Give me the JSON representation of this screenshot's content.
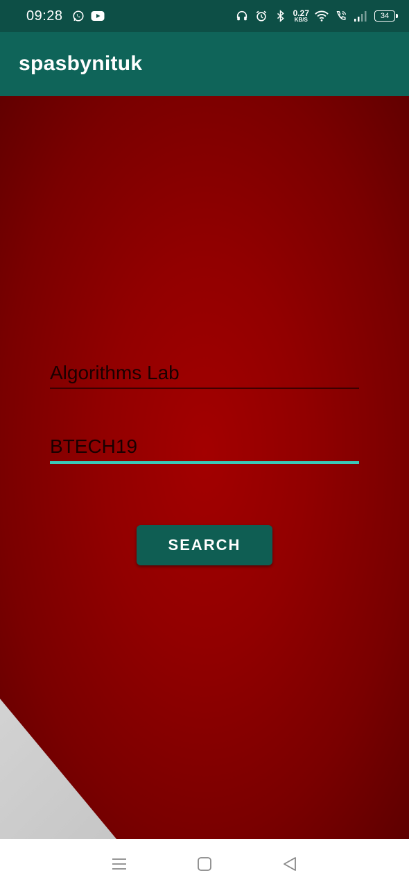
{
  "status_bar": {
    "time": "09:28",
    "net_speed_value": "0.27",
    "net_speed_unit": "KB/S",
    "battery": "34",
    "icons": [
      "whatsapp-icon",
      "youtube-icon",
      "headphones-icon",
      "alarm-icon",
      "bluetooth-icon",
      "wifi-icon",
      "call-icon",
      "signal-icon",
      "battery-icon"
    ]
  },
  "app_bar": {
    "title": "spasbynituk"
  },
  "form": {
    "subject_value": "Algorithms Lab",
    "batch_value": "BTECH19",
    "search_label": "SEARCH"
  },
  "nav_bar": {
    "icons": [
      "menu-icon",
      "home-icon",
      "back-icon"
    ]
  },
  "colors": {
    "status_bar": "#0d4f46",
    "app_bar": "#0f6459",
    "background": "#920000",
    "accent": "#3ac9b8",
    "button": "#0f5e53"
  }
}
